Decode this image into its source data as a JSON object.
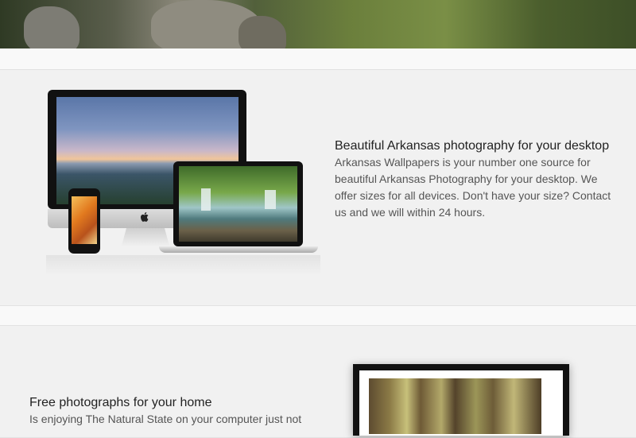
{
  "hero": {
    "image": "forest-hero-banner"
  },
  "section1": {
    "heading": "Beautiful Arkansas photography for your desktop",
    "body": "Arkansas Wallpapers is your number one source for beautiful Arkansas Photography for your desktop. We offer sizes for all devices. Don't have your size? Contact us and we will within 24 hours.",
    "image": "devices-mockup"
  },
  "section2": {
    "heading": "Free photographs for your home",
    "body": "Is enjoying The Natural State on your computer just not",
    "image": "framed-forest-photo"
  }
}
